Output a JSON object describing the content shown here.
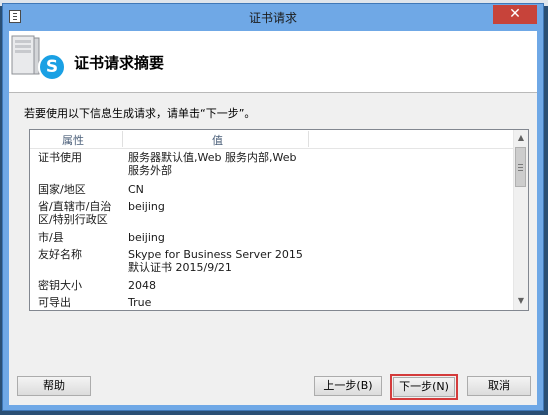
{
  "window": {
    "title": "证书请求",
    "close_glyph": "✕"
  },
  "header": {
    "title": "证书请求摘要",
    "logo_letter": "S"
  },
  "instruction": "若要使用以下信息生成请求，请单击“下一步”。",
  "table": {
    "columns": [
      "属性",
      "值"
    ],
    "rows": [
      {
        "key": "证书使用",
        "value": "服务器默认值,Web 服务内部,Web 服务外部"
      },
      {
        "key": "国家/地区",
        "value": "CN"
      },
      {
        "key": "省/直辖市/自治区/特别行政区",
        "value": "beijing"
      },
      {
        "key": "市/县",
        "value": "beijing"
      },
      {
        "key": "友好名称",
        "value": "Skype for Business Server 2015 默认证书 2015/9/21"
      },
      {
        "key": "密钥大小",
        "value": "2048"
      },
      {
        "key": "可导出",
        "value": "True"
      }
    ]
  },
  "buttons": {
    "help": "帮助",
    "back": "上一步(B)",
    "next": "下一步(N)",
    "cancel": "取消"
  },
  "colors": {
    "title_bar": "#6fa8e6",
    "close_button": "#c7433a",
    "highlight": "#d43b3b",
    "skype": "#1aa0e4"
  }
}
